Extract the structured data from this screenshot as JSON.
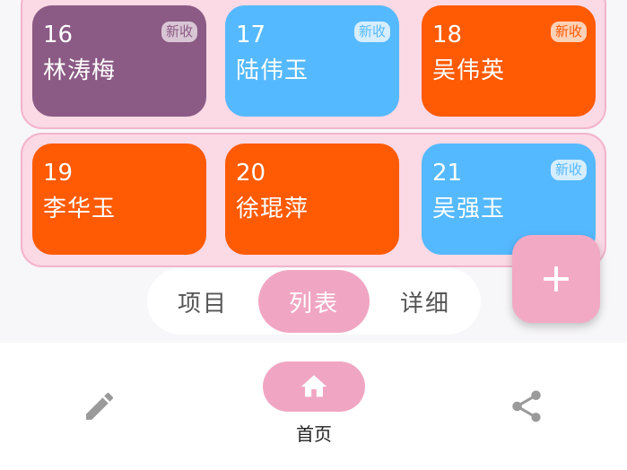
{
  "groups": [
    {
      "cards": [
        {
          "number": "16",
          "name": "林涛梅",
          "badge": "新收",
          "color": "#8b5a85"
        },
        {
          "number": "17",
          "name": "陆伟玉",
          "badge": "新收",
          "color": "#55b9ff"
        },
        {
          "number": "18",
          "name": "吴伟英",
          "badge": "新收",
          "color": "#ff5a04"
        }
      ]
    },
    {
      "cards": [
        {
          "number": "19",
          "name": "李华玉",
          "color": "#ff5a04"
        },
        {
          "number": "20",
          "name": "徐琨萍",
          "color": "#ff5a04"
        },
        {
          "number": "21",
          "name": "吴强玉",
          "badge": "新收",
          "color": "#55b9ff"
        }
      ]
    }
  ],
  "view_switch": {
    "options": [
      "项目",
      "列表",
      "详细"
    ],
    "selected": "列表"
  },
  "fab": {
    "icon": "plus-icon"
  },
  "bottom_nav": {
    "items": [
      {
        "icon": "edit-icon"
      },
      {
        "icon": "home-icon",
        "label": "首页",
        "selected": true
      },
      {
        "icon": "share-icon"
      }
    ]
  },
  "colors": {
    "accent_pink": "#f0a6c3",
    "group_background": "#fbd9e5",
    "purple": "#8b5a85",
    "blue": "#55b9ff",
    "orange": "#ff5a04"
  }
}
